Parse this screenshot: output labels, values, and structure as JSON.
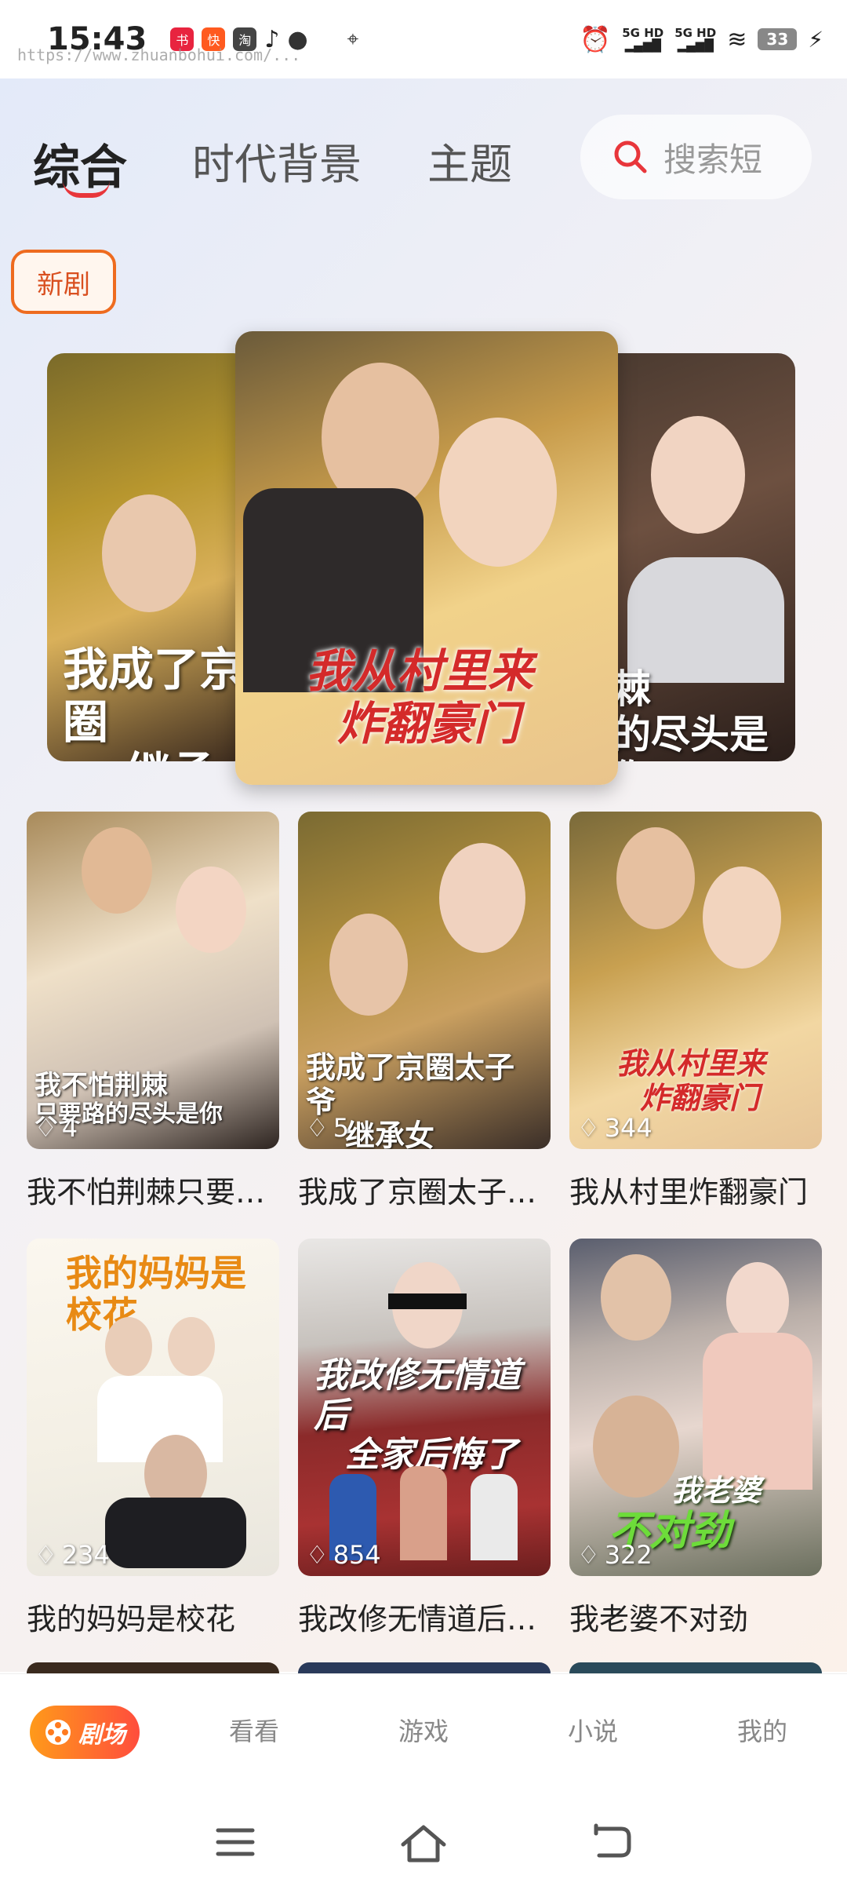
{
  "status_bar": {
    "time": "15:43",
    "url_overlay": "https://www.zhuanbohui.com/...",
    "network_1": "5G HD",
    "network_2": "5G HD",
    "battery": "33",
    "app_icons": [
      "xiaohongshu-icon",
      "kuaishou-icon",
      "taobao-icon",
      "tiktok-icon",
      "message-icon",
      "location-icon"
    ]
  },
  "tabs": {
    "active": "综合",
    "items": [
      "时代背景",
      "主题情"
    ]
  },
  "search": {
    "placeholder": "搜索短"
  },
  "new_badge": "新剧",
  "carousel": {
    "left": {
      "title_line1": "我成了京圈",
      "title_line2": "继承女"
    },
    "center": {
      "title_line1": "我从村里来",
      "title_line2": "炸翻豪门"
    },
    "right": {
      "title_line1": "棘",
      "title_line2": "的尽头是你"
    }
  },
  "grid": [
    {
      "title": "我不怕荆棘只要…",
      "views": "4",
      "overlay_line1": "我不怕荆棘",
      "overlay_line2": "只要路的尽头是你"
    },
    {
      "title": "我成了京圈太子…",
      "views": "5",
      "overlay_line1": "我成了京圈太子爷",
      "overlay_line2": "继承女"
    },
    {
      "title": "我从村里炸翻豪门",
      "views": "344",
      "overlay_line1": "我从村里来",
      "overlay_line2": "炸翻豪门"
    },
    {
      "title": "我的妈妈是校花",
      "views": "234",
      "overlay_line1": "我的妈妈是校花",
      "overlay_line2": ""
    },
    {
      "title": "我改修无情道后…",
      "views": "854",
      "overlay_line1": "我改修无情道后",
      "overlay_line2": "全家后悔了"
    },
    {
      "title": "我老婆不对劲",
      "views": "322",
      "overlay_line1": "我老婆",
      "overlay_line2": "不对劲"
    }
  ],
  "bottom_nav": {
    "active": "剧场",
    "items": [
      "看看",
      "游戏",
      "小说",
      "我的"
    ]
  },
  "colors": {
    "accent": "#e8363b",
    "badge_border": "#ee6b1f",
    "nav_gradient_start": "#ff9a1a",
    "nav_gradient_end": "#ff4d3d"
  }
}
